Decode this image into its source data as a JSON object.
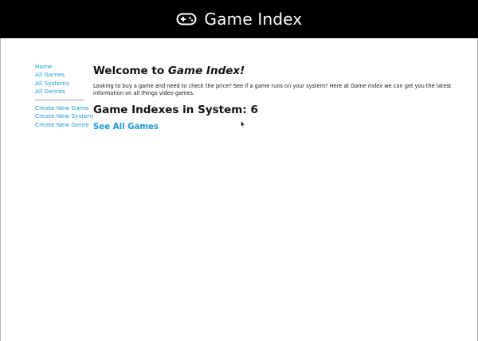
{
  "header": {
    "title": "Game Index",
    "icon": "gamepad-icon",
    "background": "#000000"
  },
  "sidebar": {
    "primary_links": [
      {
        "label": "Home"
      },
      {
        "label": "All Games"
      },
      {
        "label": "All Systems"
      },
      {
        "label": "All Genres"
      }
    ],
    "secondary_links": [
      {
        "label": "Create New Game"
      },
      {
        "label": "Create New System"
      },
      {
        "label": "Create New Genre"
      }
    ],
    "link_color": "#1a9ad6"
  },
  "main": {
    "welcome_prefix": "Welcome to ",
    "welcome_brand": "Game Index!",
    "intro_before": "Looking to buy a game and need to check the price? See if a game runs on your system? Here at ",
    "intro_brand": "Game Index",
    "intro_after": " we can get you the latest information on all things video games.",
    "count_heading": "Game Indexes in System: 6",
    "see_all_label": "See All Games"
  },
  "cursor": "pointer-cursor-icon"
}
